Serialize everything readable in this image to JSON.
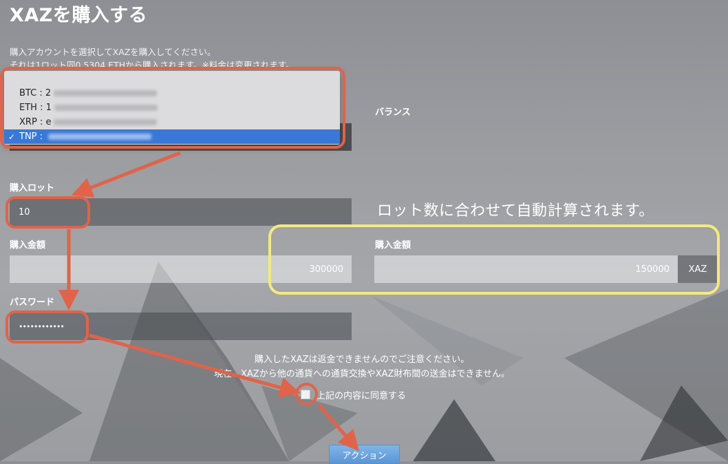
{
  "page": {
    "title": "XAZを購入する"
  },
  "intro": {
    "line1": "購入アカウントを選択してXAZを購入してください。",
    "line2": "それは1ロット同0.5304 ETHから購入されます。※料金は変更されます。"
  },
  "account_select": {
    "options": [
      {
        "currency": "BTC",
        "balance": "2"
      },
      {
        "currency": "ETH",
        "balance": "1"
      },
      {
        "currency": "XRP",
        "balance": "e"
      },
      {
        "currency": "TNP",
        "balance": "",
        "selected": true
      }
    ],
    "checkmark": "✓"
  },
  "balance": {
    "label": "バランス"
  },
  "lots": {
    "label": "購入ロット",
    "value": "10"
  },
  "purchase_amount": {
    "label": "購入金額",
    "value": "300000"
  },
  "password": {
    "label": "パスワード",
    "value": "••••••••••••"
  },
  "auto_calc": {
    "note": "ロット数に合わせて自動計算されます。"
  },
  "purchase_amount_xaz": {
    "label": "購入金額",
    "value": "150000",
    "unit": "XAZ"
  },
  "warning": {
    "line1": "購入したXAZは返金できませんのでご注意ください。",
    "line2": "現在、XAZから他の通貨への通貨交換やXAZ財布間の送金はできません。"
  },
  "agreement": {
    "label": "上記の内容に同意する",
    "checked": false
  },
  "action": {
    "label": "アクション"
  },
  "colors": {
    "annotation_red": "#e0634a",
    "annotation_yellow": "#f4ea7c",
    "selected_option": "#3a78d8",
    "button_blue": "#5b96d3"
  },
  "icons": {
    "checkmark": "check-icon"
  }
}
